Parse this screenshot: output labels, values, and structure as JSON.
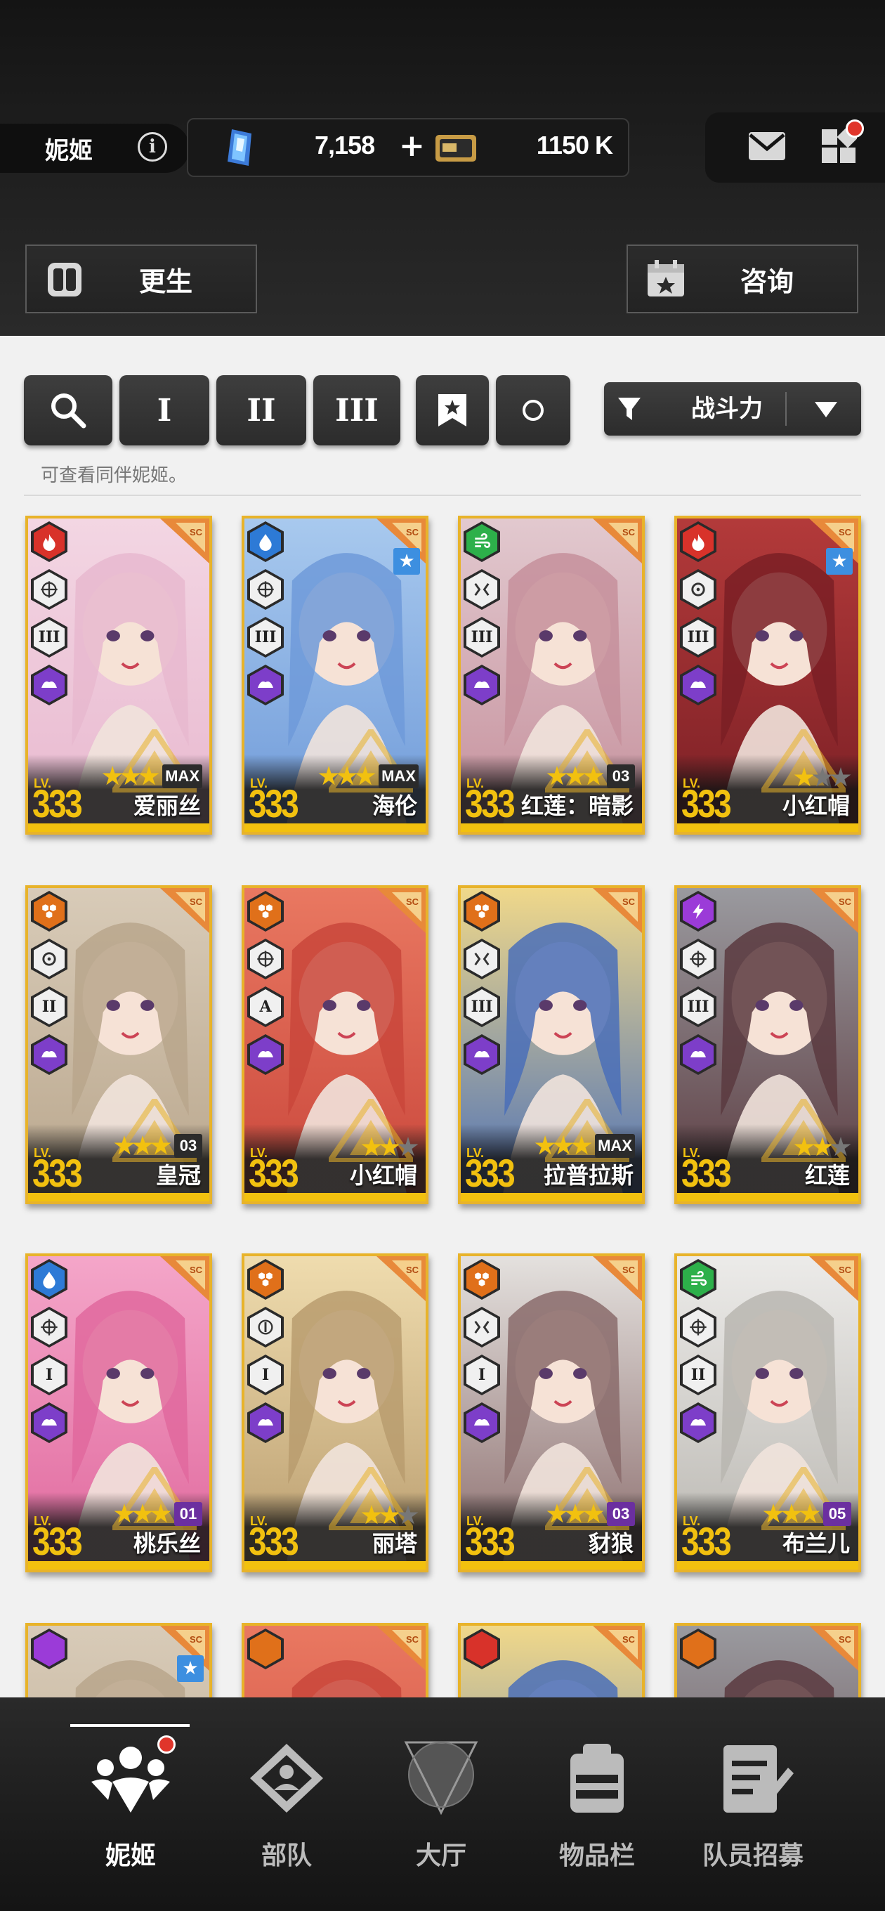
{
  "header": {
    "tab_name": "妮姬",
    "gem_value": "7,158",
    "gem_plus": "+",
    "credit_value": "1150 K"
  },
  "actions": {
    "rebirth_label": "更生",
    "consult_label": "咨询"
  },
  "filters": {
    "class_1": "I",
    "class_2": "II",
    "class_3": "III",
    "sort_label": "战斗力",
    "hint": "可查看同伴妮姬。"
  },
  "cards": [
    {
      "name": "爱丽丝",
      "level": "333",
      "lv_label": "LV.",
      "element": "fire",
      "element_color": "#d8322a",
      "burst": "III",
      "weapon": "target",
      "stars": 3,
      "badge": "MAX",
      "badge_style": "dark",
      "fav": false
    },
    {
      "name": "海伦",
      "level": "333",
      "lv_label": "LV.",
      "element": "water",
      "element_color": "#2d7ad6",
      "burst": "III",
      "weapon": "target",
      "stars": 3,
      "badge": "MAX",
      "badge_style": "dark",
      "fav": true
    },
    {
      "name": "红莲：暗影",
      "level": "333",
      "lv_label": "LV.",
      "element": "wind",
      "element_color": "#2db04a",
      "burst": "III",
      "weapon": "spread",
      "stars": 3,
      "badge": "03",
      "badge_style": "dark",
      "fav": false
    },
    {
      "name": "小红帽",
      "level": "333",
      "lv_label": "LV.",
      "element": "fire",
      "element_color": "#d8322a",
      "burst": "III",
      "weapon": "circle",
      "stars": 1,
      "badge": "",
      "badge_style": "dark",
      "fav": true
    },
    {
      "name": "皇冠",
      "level": "333",
      "lv_label": "LV.",
      "element": "iron",
      "element_color": "#e0701a",
      "burst": "II",
      "weapon": "circle",
      "stars": 3,
      "badge": "03",
      "badge_style": "dark",
      "fav": false
    },
    {
      "name": "小红帽",
      "level": "333",
      "lv_label": "LV.",
      "element": "iron",
      "element_color": "#e0701a",
      "burst": "A",
      "weapon": "target",
      "stars": 2,
      "badge": "",
      "badge_style": "dark",
      "fav": false
    },
    {
      "name": "拉普拉斯",
      "level": "333",
      "lv_label": "LV.",
      "element": "iron",
      "element_color": "#e0701a",
      "burst": "III",
      "weapon": "spread",
      "stars": 3,
      "badge": "MAX",
      "badge_style": "dark",
      "fav": false
    },
    {
      "name": "红莲",
      "level": "333",
      "lv_label": "LV.",
      "element": "electric",
      "element_color": "#9b3bd8",
      "burst": "III",
      "weapon": "cross",
      "stars": 2,
      "badge": "",
      "badge_style": "dark",
      "fav": false
    },
    {
      "name": "桃乐丝",
      "level": "333",
      "lv_label": "LV.",
      "element": "water",
      "element_color": "#2d7ad6",
      "burst": "I",
      "weapon": "cross",
      "stars": 3,
      "badge": "01",
      "badge_style": "purple",
      "fav": false
    },
    {
      "name": "丽塔",
      "level": "333",
      "lv_label": "LV.",
      "element": "iron",
      "element_color": "#e0701a",
      "burst": "I",
      "weapon": "rifle",
      "stars": 2,
      "badge": "",
      "badge_style": "dark",
      "fav": false
    },
    {
      "name": "豺狼",
      "level": "333",
      "lv_label": "LV.",
      "element": "iron",
      "element_color": "#e0701a",
      "burst": "I",
      "weapon": "spread",
      "stars": 3,
      "badge": "03",
      "badge_style": "purple",
      "fav": false
    },
    {
      "name": "布兰儿",
      "level": "333",
      "lv_label": "LV.",
      "element": "wind",
      "element_color": "#2db04a",
      "burst": "II",
      "weapon": "cross",
      "stars": 3,
      "badge": "05",
      "badge_style": "purple",
      "fav": false
    }
  ],
  "partial_cards": [
    {
      "element_color": "#9b3bd8",
      "fav": true
    },
    {
      "element_color": "#e0701a",
      "fav": false
    },
    {
      "element_color": "#d8322a",
      "fav": false
    },
    {
      "element_color": "#e0701a",
      "fav": false
    }
  ],
  "nav": {
    "items": [
      {
        "label": "妮姬",
        "icon": "nikke-icon",
        "active": true,
        "dot": true
      },
      {
        "label": "部队",
        "icon": "squad-icon",
        "active": false,
        "dot": false
      },
      {
        "label": "大厅",
        "icon": "lobby-icon",
        "active": false,
        "dot": false
      },
      {
        "label": "物品栏",
        "icon": "inventory-icon",
        "active": false,
        "dot": false
      },
      {
        "label": "队员招募",
        "icon": "recruit-icon",
        "active": false,
        "dot": false
      }
    ]
  },
  "colors": {
    "gold": "#f2c10f",
    "card_border": "#e8b32a",
    "accent_red": "#e0352b"
  }
}
